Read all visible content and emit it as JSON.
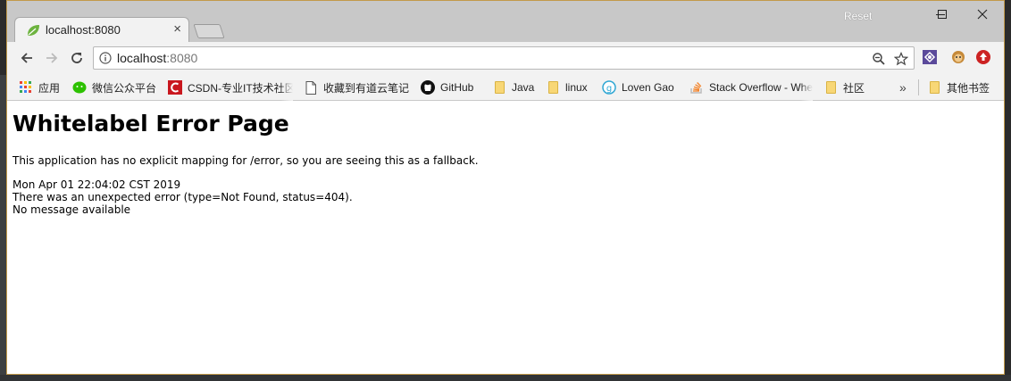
{
  "tab": {
    "title": "localhost:8080",
    "close": "×"
  },
  "titlebar": {
    "reset_label": "Reset"
  },
  "address": {
    "host": "localhost",
    "port": ":8080"
  },
  "bookmarks": {
    "items": [
      {
        "label": "应用",
        "icon": "apps-grid-icon"
      },
      {
        "label": "微信公众平台",
        "icon": "wechat-icon"
      },
      {
        "label": "CSDN-专业IT技术社区",
        "icon": "csdn-icon"
      },
      {
        "label": "收藏到有道云笔记",
        "icon": "page-icon"
      },
      {
        "label": "GitHub",
        "icon": "github-icon"
      },
      {
        "label": "Java",
        "icon": "folder-icon"
      },
      {
        "label": "linux",
        "icon": "folder-icon"
      },
      {
        "label": "Loven Gao",
        "icon": "loven-icon"
      },
      {
        "label": "Stack Overflow - Where Developers Learn",
        "icon": "stackoverflow-icon"
      },
      {
        "label": "社区",
        "icon": "folder-icon"
      }
    ],
    "overflow": "»",
    "other": {
      "label": "其他书签",
      "icon": "folder-icon"
    }
  },
  "page": {
    "title": "Whitelabel Error Page",
    "description": "This application has no explicit mapping for /error, so you are seeing this as a fallback.",
    "timestamp": "Mon Apr 01 22:04:02 CST 2019",
    "error": "There was an unexpected error (type=Not Found, status=404).",
    "message": "No message available"
  },
  "colors": {
    "window_border": "#c29a4a",
    "titlebar": "#c8c8c8",
    "toolbar": "#f2f2f2",
    "error_ext": "#cc2222"
  }
}
